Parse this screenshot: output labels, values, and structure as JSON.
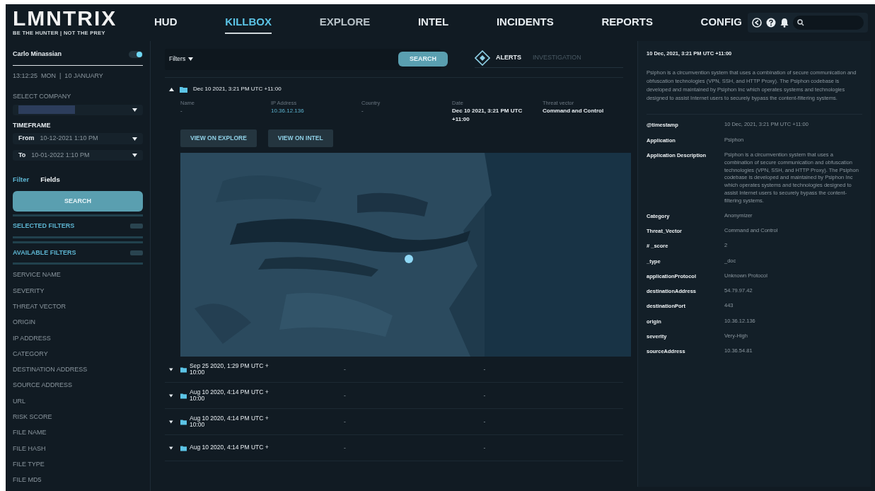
{
  "brand": {
    "name": "LMNTRIX",
    "tagline": "BE THE HUNTER | NOT THE PREY"
  },
  "nav": [
    {
      "label": "HUD",
      "selected": false
    },
    {
      "label": "KILLBOX",
      "selected": true
    },
    {
      "label": "EXPLORE",
      "selected": false
    },
    {
      "label": "INTEL",
      "selected": false
    },
    {
      "label": "INCIDENTS",
      "selected": false
    },
    {
      "label": "REPORTS",
      "selected": false
    },
    {
      "label": "CONFIG",
      "selected": false
    }
  ],
  "sidebar": {
    "user": "Carlo Minassian",
    "toggle_on": true,
    "clock": "13:12:25  MON  |  10 JANUARY",
    "company_label": "SELECT COMPANY",
    "timeframe_label": "TIMEFRAME",
    "from": {
      "label": "From",
      "value": "10-12-2021 1:10 PM"
    },
    "to": {
      "label": "To",
      "value": "10-01-2022 1:10 PM"
    },
    "tabs": [
      {
        "label": "Filter",
        "selected": true
      },
      {
        "label": "Fields",
        "selected": false
      }
    ],
    "search_button": "SEARCH",
    "sections": [
      {
        "title": "SELECTED FILTERS"
      },
      {
        "title": "AVAILABLE FILTERS"
      }
    ],
    "filters": [
      "SERVICE NAME",
      "SEVERITY",
      "THREAT VECTOR",
      "ORIGIN",
      "IP ADDRESS",
      "CATEGORY",
      "DESTINATION ADDRESS",
      "SOURCE ADDRESS",
      "URL",
      "RISK SCORE",
      "FILE NAME",
      "FILE HASH",
      "FILE TYPE",
      "FILE MD5"
    ]
  },
  "toolbar": {
    "filters_label": "Filters",
    "search_button": "SEARCH",
    "tabs": [
      {
        "label": "ALERTS",
        "selected": true
      },
      {
        "label": "INVESTIGATION",
        "selected": false
      }
    ]
  },
  "alerts": [
    {
      "title": "Dec 10 2021, 3:21 PM UTC +11:00",
      "expanded": true,
      "fields": [
        {
          "label": "Name",
          "value": "-",
          "kind": "text"
        },
        {
          "label": "IP Address",
          "value": "10.36.12.136",
          "kind": "link"
        },
        {
          "label": "Country",
          "value": "-",
          "kind": "text"
        },
        {
          "label": "Date",
          "value": "Dec 10 2021, 3:21 PM UTC +11:00",
          "kind": "strong"
        },
        {
          "label": "Threat vector",
          "value": "Command and Control",
          "kind": "strong"
        }
      ],
      "actions": [
        "VIEW ON EXPLORE",
        "VIEW ON INTEL"
      ]
    },
    {
      "title": "Sep 25 2020, 1:29 PM UTC + 10:00",
      "expanded": false,
      "columns": [
        "-",
        "-"
      ]
    },
    {
      "title": "Aug 10 2020, 4:14 PM UTC + 10:00",
      "expanded": false,
      "columns": [
        "-",
        "-"
      ]
    },
    {
      "title": "Aug 10 2020, 4:14 PM UTC + 10:00",
      "expanded": false,
      "columns": [
        "-",
        "-"
      ]
    },
    {
      "title": "Aug 10 2020, 4:14 PM UTC +",
      "expanded": false,
      "columns": [
        "-",
        "-"
      ]
    }
  ],
  "detail": {
    "title": "10 Dec, 2021, 3:21 PM UTC +11:00",
    "summary": "Psiphon is a circumvention system that uses a combination of secure communication and obfuscation technologies (VPN, SSH, and HTTP Proxy). The Psiphon codebase is developed and maintained by Psiphon Inc which operates systems and technologies designed to assist Internet users to securely bypass the content-filtering systems.",
    "rows": [
      {
        "label": "@timestamp",
        "value": "10 Dec, 2021, 3:21 PM UTC +11:00"
      },
      {
        "label": "Application",
        "value": "Psiphon"
      },
      {
        "label": "Application Description",
        "value": "Psiphon is a circumvention system that uses a combination of secure communication and obfuscation technologies (VPN, SSH, and HTTP Proxy). The Psiphon codebase is developed and maintained by Psiphon Inc which operates systems and technologies designed to assist Internet users to securely bypass the content-filtering systems."
      },
      {
        "label": "Category",
        "value": "Anonymizer"
      },
      {
        "label": "Threat_Vector",
        "value": "Command and Control"
      },
      {
        "label": "# _score",
        "value": "2"
      },
      {
        "label": "_type",
        "value": "_doc"
      },
      {
        "label": "applicationProtocol",
        "value": "Unknown Protocol"
      },
      {
        "label": "destinationAddress",
        "value": "54.79.97.42"
      },
      {
        "label": "destinationPort",
        "value": "443"
      },
      {
        "label": "origin",
        "value": "10.36.12.136"
      },
      {
        "label": "severity",
        "value": "Very-High"
      },
      {
        "label": "sourceAddress",
        "value": "10.36.54.81"
      }
    ]
  }
}
